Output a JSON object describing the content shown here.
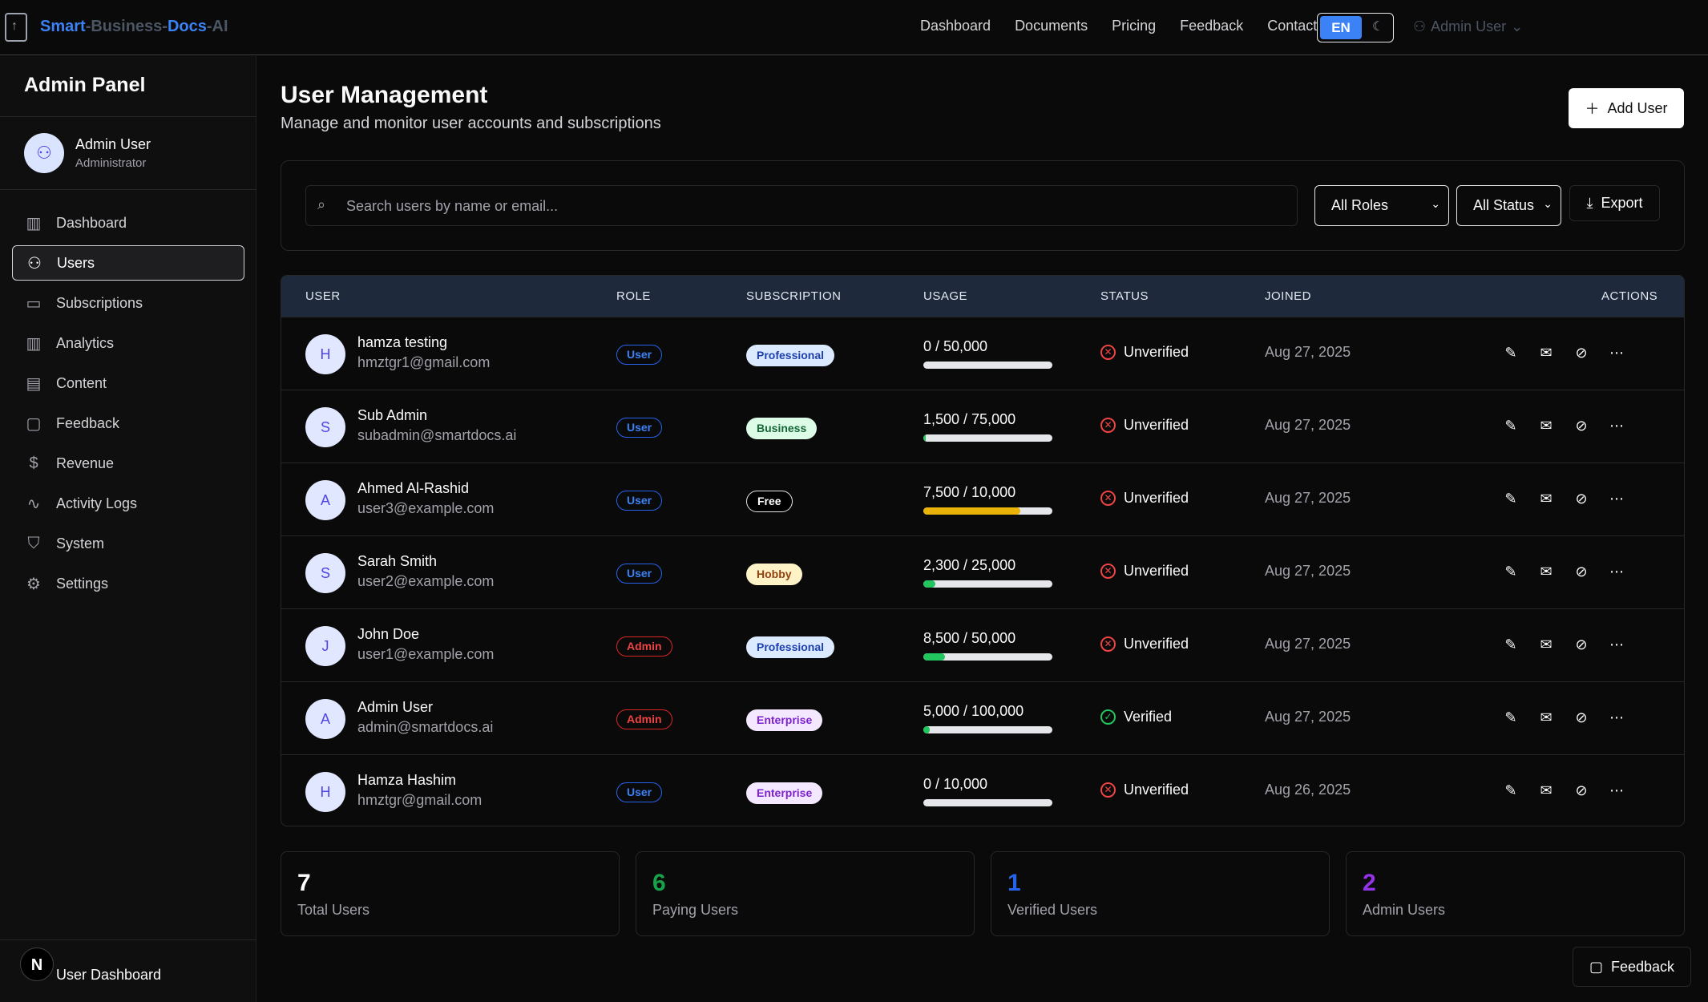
{
  "brand": {
    "part1": "Smart",
    "part2": "-Business-",
    "part3": "Docs",
    "part4": "-AI"
  },
  "topnav": {
    "links": [
      "Dashboard",
      "Documents",
      "Pricing",
      "Feedback",
      "Contact"
    ],
    "lang": "EN",
    "user": "Admin User"
  },
  "sidebar": {
    "title": "Admin Panel",
    "user_name": "Admin User",
    "user_role": "Administrator",
    "items": [
      {
        "label": "Dashboard",
        "icon": "bar-chart-icon"
      },
      {
        "label": "Users",
        "icon": "users-icon"
      },
      {
        "label": "Subscriptions",
        "icon": "credit-card-icon"
      },
      {
        "label": "Analytics",
        "icon": "analytics-icon"
      },
      {
        "label": "Content",
        "icon": "document-icon"
      },
      {
        "label": "Feedback",
        "icon": "message-icon"
      },
      {
        "label": "Revenue",
        "icon": "dollar-icon"
      },
      {
        "label": "Activity Logs",
        "icon": "activity-icon"
      },
      {
        "label": "System",
        "icon": "shield-icon"
      },
      {
        "label": "Settings",
        "icon": "gear-icon"
      }
    ],
    "active": "Users",
    "bottom_badge": "N",
    "bottom_link": "User Dashboard"
  },
  "header": {
    "title": "User Management",
    "subtitle": "Manage and monitor user accounts and subscriptions",
    "add_button": "Add User"
  },
  "filters": {
    "search_placeholder": "Search users by name or email...",
    "role_select": "All Roles",
    "status_select": "All Status",
    "export": "Export"
  },
  "table": {
    "headers": [
      "USER",
      "ROLE",
      "SUBSCRIPTION",
      "USAGE",
      "STATUS",
      "JOINED",
      "ACTIONS"
    ],
    "rows": [
      {
        "initial": "H",
        "name": "hamza testing",
        "email": "hmztgr1@gmail.com",
        "role": "User",
        "subscription": "Professional",
        "usage": "0 / 50,000",
        "usage_fraction": 0,
        "status": "Unverified",
        "joined": "Aug 27, 2025"
      },
      {
        "initial": "S",
        "name": "Sub Admin",
        "email": "subadmin@smartdocs.ai",
        "role": "User",
        "subscription": "Business",
        "usage": "1,500 / 75,000",
        "usage_fraction": 0.02,
        "status": "Unverified",
        "joined": "Aug 27, 2025"
      },
      {
        "initial": "A",
        "name": "Ahmed Al-Rashid",
        "email": "user3@example.com",
        "role": "User",
        "subscription": "Free",
        "usage": "7,500 / 10,000",
        "usage_fraction": 0.75,
        "status": "Unverified",
        "joined": "Aug 27, 2025"
      },
      {
        "initial": "S",
        "name": "Sarah Smith",
        "email": "user2@example.com",
        "role": "User",
        "subscription": "Hobby",
        "usage": "2,300 / 25,000",
        "usage_fraction": 0.092,
        "status": "Unverified",
        "joined": "Aug 27, 2025"
      },
      {
        "initial": "J",
        "name": "John Doe",
        "email": "user1@example.com",
        "role": "Admin",
        "subscription": "Professional",
        "usage": "8,500 / 50,000",
        "usage_fraction": 0.17,
        "status": "Unverified",
        "joined": "Aug 27, 2025"
      },
      {
        "initial": "A",
        "name": "Admin User",
        "email": "admin@smartdocs.ai",
        "role": "Admin",
        "subscription": "Enterprise",
        "usage": "5,000 / 100,000",
        "usage_fraction": 0.05,
        "status": "Verified",
        "joined": "Aug 27, 2025"
      },
      {
        "initial": "H",
        "name": "Hamza Hashim",
        "email": "hmztgr@gmail.com",
        "role": "User",
        "subscription": "Enterprise",
        "usage": "0 / 10,000",
        "usage_fraction": 0,
        "status": "Unverified",
        "joined": "Aug 26, 2025"
      }
    ]
  },
  "stats": [
    {
      "value": "7",
      "label": "Total Users",
      "color": "#ffffff"
    },
    {
      "value": "6",
      "label": "Paying Users",
      "color": "#16a34a"
    },
    {
      "value": "1",
      "label": "Verified Users",
      "color": "#2563eb"
    },
    {
      "value": "2",
      "label": "Admin Users",
      "color": "#9333ea"
    }
  ],
  "colors": {
    "usage_green": "#22c55e",
    "usage_amber": "#eab308",
    "accent": "#3b82f6"
  },
  "feedback_button": "Feedback"
}
